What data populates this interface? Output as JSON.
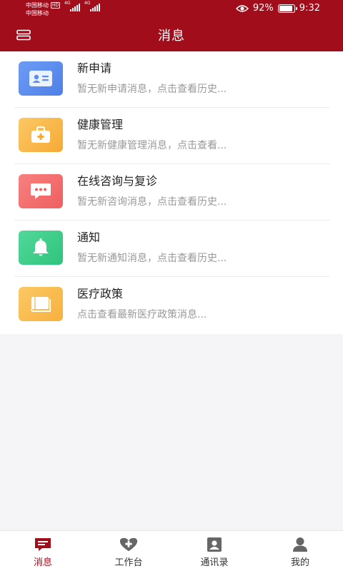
{
  "status_bar": {
    "carrier1": "中国移动",
    "carrier1_badge": "HD",
    "carrier2": "中国移动",
    "net1": "4G",
    "net2": "4G",
    "battery_percent": "92%",
    "battery_level": 0.92,
    "time": "9:32"
  },
  "header": {
    "title": "消息",
    "menu_icon": "menu-icon"
  },
  "colors": {
    "primary": "#a20d1c",
    "application": "#5b8def",
    "health": "#f9b94a",
    "consult": "#f46e6e",
    "notice": "#3fce8a",
    "policy": "#f9be4e"
  },
  "messages": [
    {
      "title": "新申请",
      "subtitle": "暂无新申请消息，点击查看历史...",
      "icon": "id-card-icon"
    },
    {
      "title": "健康管理",
      "subtitle": "暂无新健康管理消息，点击查看...",
      "icon": "medical-kit-icon"
    },
    {
      "title": "在线咨询与复诊",
      "subtitle": "暂无新咨询消息，点击查看历史...",
      "icon": "chat-bubble-icon"
    },
    {
      "title": "通知",
      "subtitle": "暂无新通知消息，点击查看历史...",
      "icon": "bell-icon"
    },
    {
      "title": "医疗政策",
      "subtitle": "点击查看最新医疗政策消息...",
      "icon": "book-icon"
    }
  ],
  "bottom_nav": [
    {
      "label": "消息",
      "icon": "message-icon",
      "active": true
    },
    {
      "label": "工作台",
      "icon": "heart-plus-icon",
      "active": false
    },
    {
      "label": "通讯录",
      "icon": "contacts-icon",
      "active": false
    },
    {
      "label": "我的",
      "icon": "profile-icon",
      "active": false
    }
  ]
}
